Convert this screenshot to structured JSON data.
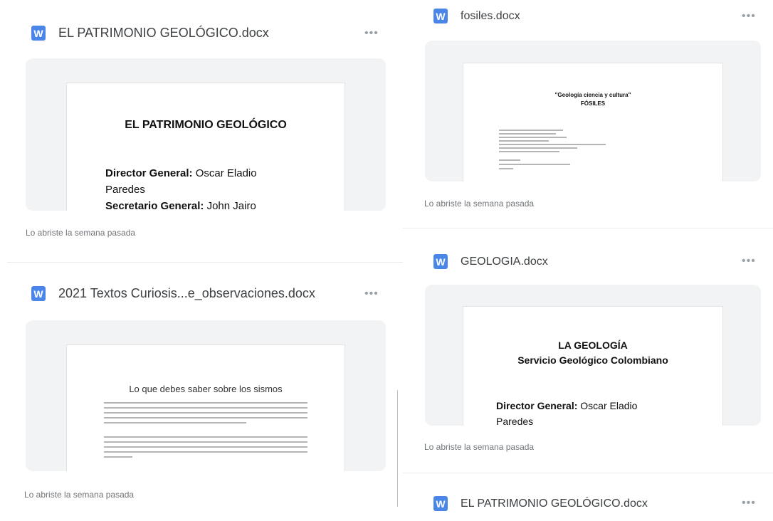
{
  "files": [
    {
      "name": "EL PATRIMONIO GEOLÓGICO.docx",
      "meta": "Lo abriste la semana pasada",
      "preview": {
        "title": "EL PATRIMONIO GEOLÓGICO",
        "lines": [
          {
            "label": "Director General:",
            "value": " Oscar Eladio"
          },
          {
            "label": "",
            "value": "Paredes"
          },
          {
            "label": "Secretario General:",
            "value": " John Jairo"
          }
        ]
      }
    },
    {
      "name": "2021 Textos Curiosis...e_observaciones.docx",
      "meta": "Lo abriste la semana pasada",
      "preview": {
        "title": "Lo que debes saber sobre los sismos"
      }
    },
    {
      "name": "fosiles.docx",
      "meta": "Lo abriste la semana pasada",
      "preview": {
        "title": "\"Geología ciencia y cultura\"",
        "subtitle": "FÓSILES"
      }
    },
    {
      "name": "GEOLOGIA.docx",
      "meta": "Lo abriste la semana pasada",
      "preview": {
        "title": "LA GEOLOGÍA",
        "subtitle": "Servicio Geológico Colombiano",
        "lines": [
          {
            "label": "Director General:",
            "value": " Oscar Eladio"
          },
          {
            "label": "",
            "value": "Paredes"
          }
        ]
      }
    },
    {
      "name": "EL PATRIMONIO GEOLÓGICO.docx"
    }
  ],
  "icons": {
    "word": "W",
    "more": "•••"
  }
}
